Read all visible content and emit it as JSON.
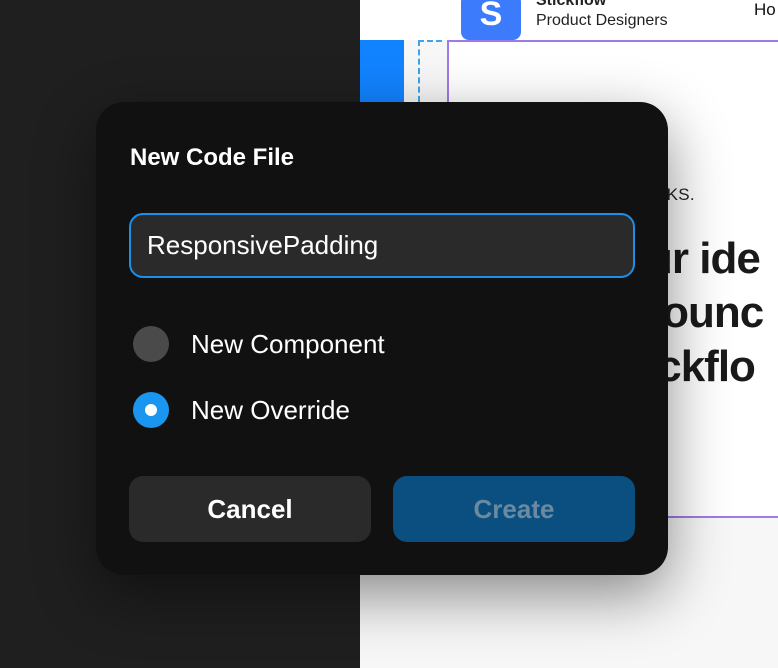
{
  "preview": {
    "brand_logo_letter": "S",
    "brand_name": "Stickflow",
    "brand_subtitle": "Product Designers",
    "nav_item": "Ho",
    "kicker_text": "EKS.",
    "hero_lines": [
      "ur ide",
      "rounc",
      "ickflo"
    ]
  },
  "dialog": {
    "title": "New Code File",
    "name_input_value": "ResponsivePadding",
    "options": [
      {
        "label": "New Component",
        "selected": false
      },
      {
        "label": "New Override",
        "selected": true
      }
    ],
    "cancel_label": "Cancel",
    "create_label": "Create"
  },
  "colors": {
    "accent": "#1b96f0",
    "input_border": "#1c8fe8",
    "create_button_disabled": "#0a4f80",
    "selection_frame": "#a07ae6",
    "brand_blue": "#3d7bfd"
  }
}
